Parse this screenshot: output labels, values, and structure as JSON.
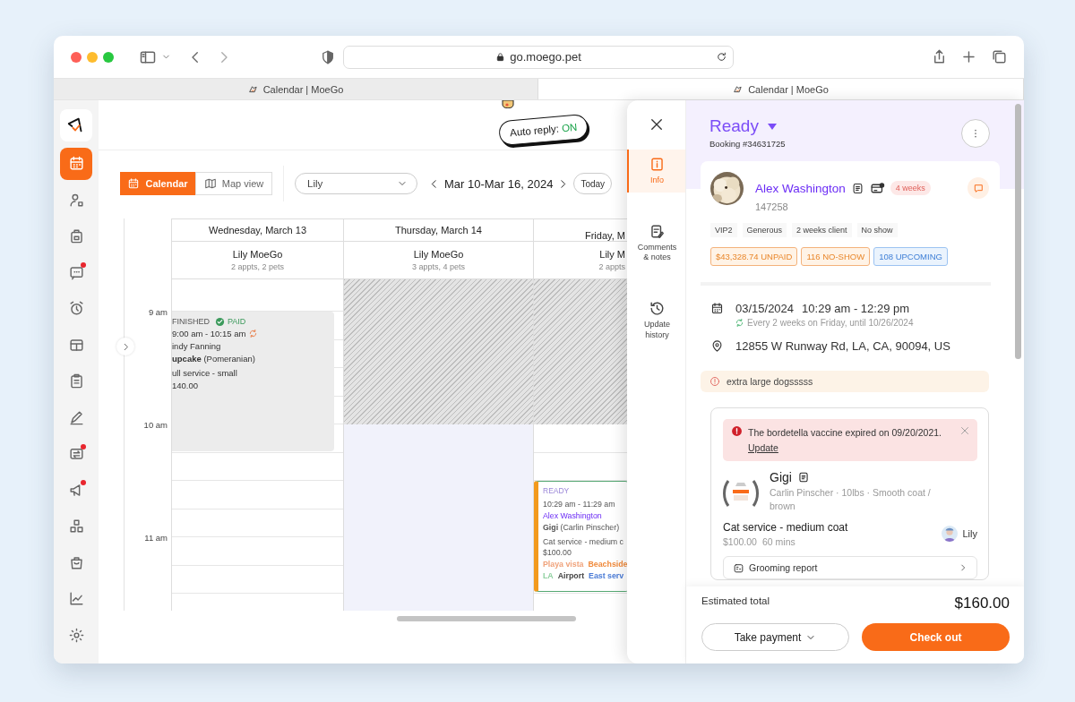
{
  "browser": {
    "url": "go.moego.pet",
    "tabs": [
      {
        "title": "Calendar | MoeGo",
        "selected": false
      },
      {
        "title": "Calendar | MoeGo",
        "selected": true
      }
    ]
  },
  "nav_items": [
    {
      "selected": true,
      "badge": false
    },
    {
      "selected": false,
      "badge": false
    },
    {
      "selected": false,
      "badge": false
    },
    {
      "selected": false,
      "badge": true
    },
    {
      "selected": false,
      "badge": false
    },
    {
      "selected": false,
      "badge": false
    },
    {
      "selected": false,
      "badge": false
    },
    {
      "selected": false,
      "badge": false
    },
    {
      "selected": false,
      "badge": true
    },
    {
      "selected": false,
      "badge": true
    },
    {
      "selected": false,
      "badge": false
    },
    {
      "selected": false,
      "badge": false
    },
    {
      "selected": false,
      "badge": false
    },
    {
      "selected": false,
      "badge": false
    }
  ],
  "auto_reply": {
    "label": "Auto reply:",
    "value": "ON"
  },
  "toolbar": {
    "views": [
      {
        "label": "Calendar",
        "selected": true
      },
      {
        "label": "Map view",
        "selected": false
      }
    ],
    "staff": "Lily",
    "range": "Mar 10-Mar 16, 2024",
    "today": "Today"
  },
  "times": [
    "9 am",
    "10 am",
    "11 am"
  ],
  "days": [
    {
      "name": "Wednesday, March 13",
      "staff": "Lily MoeGo",
      "summary": "2 appts, 2 pets",
      "unavailable": false,
      "highlighted": false,
      "appointments": [
        {
          "kind": "finished",
          "status": "FINISHED",
          "payment": "PAID",
          "time": "9:00 am - 10:15 am",
          "client": "indy Fanning",
          "pet": "**upcake** (Pomeranian)",
          "service": "ull service - small",
          "price": "140.00"
        }
      ]
    },
    {
      "name": "Thursday, March 14",
      "staff": "Lily MoeGo",
      "summary": "3 appts, 4 pets",
      "unavailable": true,
      "highlighted": true
    },
    {
      "name": "Friday, M",
      "staff": "Lily M",
      "summary": "2 appts",
      "unavailable": true,
      "highlighted": false,
      "appointments": [
        {
          "kind": "ready",
          "status": "READY",
          "time": "10:29 am - 11:29 am",
          "client": "Alex Washington",
          "pet": "**Gigi** (Carlin Pinscher)",
          "service": "Cat service - medium c",
          "price": "$100.00",
          "tags": [
            {
              "text": "Playa vista",
              "color": "#f0a27a"
            },
            {
              "text": "Beachside",
              "color": "#f08a3c"
            },
            {
              "text": "LA",
              "color": "#8fd0a0"
            },
            {
              "text": "Airport",
              "color": "#444444"
            },
            {
              "text": "East serv",
              "color": "#4a7bd6"
            }
          ]
        }
      ]
    }
  ],
  "drawer": {
    "nav": [
      {
        "label": "Info",
        "selected": true
      },
      {
        "label": "Comments & notes",
        "selected": false
      },
      {
        "label": "Update history",
        "selected": false
      }
    ],
    "status": "Ready",
    "booking": "Booking #34631725",
    "client": {
      "name": "Alex Washington",
      "id": "147258",
      "badge": "4 weeks",
      "tags": [
        "VIP2",
        "Generous",
        "2 weeks client",
        "No show"
      ],
      "stats": [
        {
          "text": "$43,328.74 UNPAID",
          "kind": "warning"
        },
        {
          "text": "116 NO-SHOW",
          "kind": "warning"
        },
        {
          "text": "108 UPCOMING",
          "kind": "info"
        }
      ]
    },
    "date": "03/15/2024",
    "time": "10:29 am - 12:29 pm",
    "recurrence": "Every 2 weeks on Friday, until 10/26/2024",
    "address": "12855 W Runway Rd, LA, CA, 90094, US",
    "note": "extra large dogsssss",
    "pet": {
      "alert": "The bordetella vaccine expired on 09/20/2021.",
      "alert_link": "Update",
      "name": "Gigi",
      "details": "Carlin Pinscher · 10lbs · Smooth coat / brown",
      "service": "Cat service - medium coat",
      "price": "$100.00",
      "duration": "60 mins",
      "staff": "Lily",
      "report": "Grooming report"
    },
    "total_label": "Estimated total",
    "total": "$160.00",
    "take_payment": "Take payment",
    "check_out": "Check out"
  }
}
